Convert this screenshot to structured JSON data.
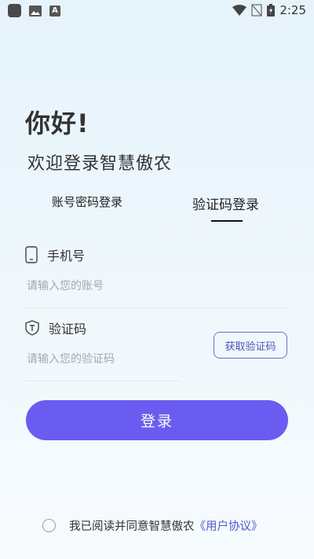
{
  "status_bar": {
    "time": "2:25"
  },
  "header": {
    "greeting": "你好!",
    "welcome": "欢迎登录智慧傲农"
  },
  "tabs": [
    {
      "label": "账号密码登录",
      "active": false
    },
    {
      "label": "验证码登录",
      "active": true
    }
  ],
  "phone_field": {
    "label": "手机号",
    "placeholder": "请输入您的账号",
    "value": ""
  },
  "code_field": {
    "label": "验证码",
    "placeholder": "请输入您的验证码",
    "value": ""
  },
  "get_code_label": "获取验证码",
  "login_label": "登录",
  "agreement": {
    "text": "我已阅读并同意智慧傲农",
    "link": "《用户协议》",
    "checked": false
  },
  "colors": {
    "accent": "#6a5cf0",
    "link": "#4a5ad0"
  }
}
